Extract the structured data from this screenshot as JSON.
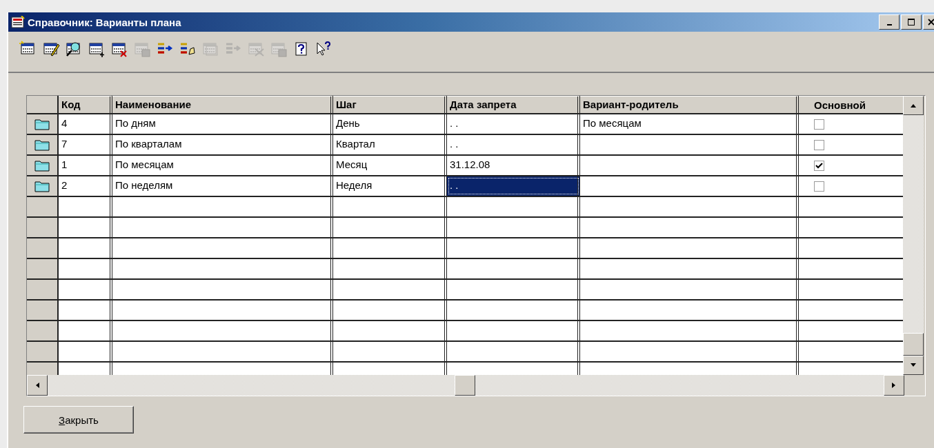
{
  "window": {
    "title": "Справочник: Варианты плана"
  },
  "toolbar": [
    {
      "kind": "new",
      "disabled": false
    },
    {
      "kind": "edit",
      "disabled": false
    },
    {
      "kind": "find",
      "disabled": false
    },
    {
      "kind": "add",
      "disabled": false
    },
    {
      "kind": "delete",
      "disabled": false
    },
    {
      "kind": "save",
      "disabled": true
    },
    {
      "kind": "move",
      "disabled": false
    },
    {
      "kind": "move-edit",
      "disabled": false
    },
    {
      "kind": "copy",
      "disabled": true
    },
    {
      "kind": "merge",
      "disabled": true
    },
    {
      "kind": "unlink",
      "disabled": true
    },
    {
      "kind": "duplicate",
      "disabled": true
    },
    {
      "kind": "help",
      "disabled": false
    },
    {
      "kind": "whatsthis",
      "disabled": false
    }
  ],
  "table": {
    "columns": [
      "Код",
      "Наименование",
      "Шаг",
      "Дата запрета",
      "Вариант-родитель",
      "Основной"
    ],
    "rows": [
      {
        "code": "4",
        "name": "По дням",
        "step": "День",
        "date": ". .",
        "parent": "По месяцам",
        "main": false,
        "selected": false
      },
      {
        "code": "7",
        "name": "По кварталам",
        "step": "Квартал",
        "date": ". .",
        "parent": "",
        "main": false,
        "selected": false
      },
      {
        "code": "1",
        "name": "По месяцам",
        "step": "Месяц",
        "date": "31.12.08",
        "parent": "",
        "main": true,
        "selected": false
      },
      {
        "code": "2",
        "name": "По неделям",
        "step": "Неделя",
        "date": ". .",
        "parent": "",
        "main": false,
        "selected": true
      }
    ]
  },
  "buttons": [
    {
      "label": "Закрыть"
    }
  ]
}
